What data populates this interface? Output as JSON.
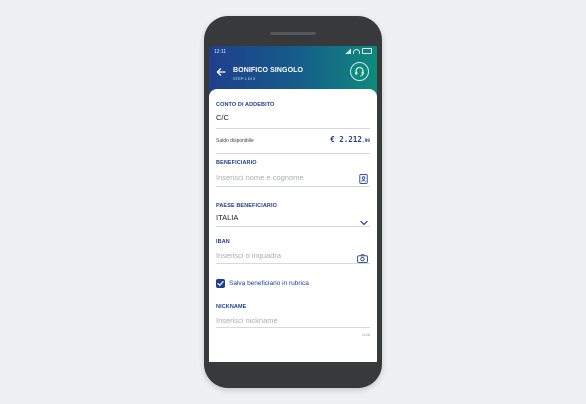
{
  "status_bar": {
    "time": "12:11"
  },
  "header": {
    "title": "BONIFICO SINGOLO",
    "subtitle": "STEP 1 DI 3",
    "back_icon": "arrow-left-icon",
    "support_icon": "headset-icon"
  },
  "form": {
    "conto": {
      "label": "CONTO DI ADDEBITO",
      "value": "C/C"
    },
    "saldo": {
      "label": "Saldo disponibile",
      "value_main": "€ 2.212",
      "value_cents": ",99"
    },
    "beneficiario": {
      "label": "BENEFICIARIO",
      "placeholder": "Inserisci nome e cognome",
      "icon": "contacts-book-icon"
    },
    "paese": {
      "label": "PAESE BENEFICIARIO",
      "value": "ITALIA",
      "icon": "chevron-down-icon"
    },
    "iban": {
      "label": "IBAN",
      "placeholder": "Inserisci o inquadra",
      "icon": "camera-icon"
    },
    "salva": {
      "label": "Salva beneficiario in rubrica",
      "checked": true
    },
    "nickname": {
      "label": "NICKNAME",
      "placeholder": "Inserisci nickname",
      "counter": "0/46"
    }
  },
  "colors": {
    "primary": "#1f3f8c",
    "teal": "#0e8a7c"
  }
}
